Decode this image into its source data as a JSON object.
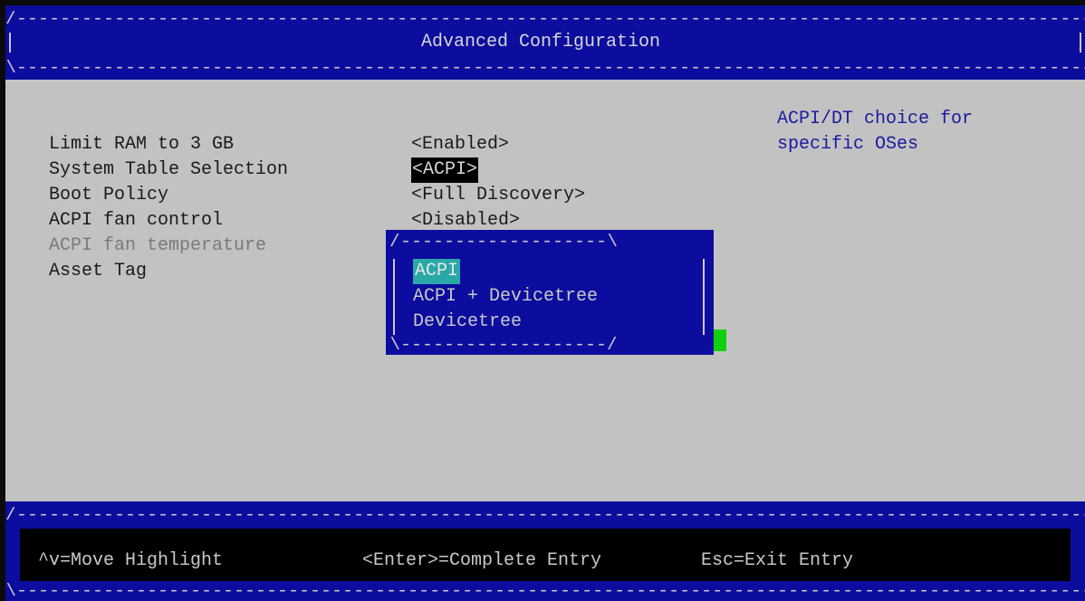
{
  "header": {
    "title": "Advanced Configuration"
  },
  "settings": [
    {
      "label": "Limit RAM to 3 GB",
      "value": "<Enabled>"
    },
    {
      "label": "System Table Selection",
      "value": "<ACPI>"
    },
    {
      "label": "Boot Policy",
      "value": "<Full Discovery>"
    },
    {
      "label": "ACPI fan control",
      "value": "<Disabled>"
    },
    {
      "label": "ACPI fan temperature",
      "value": ""
    },
    {
      "label": "Asset Tag",
      "value": ""
    }
  ],
  "help": {
    "text": "ACPI/DT choice for\nspecific OSes"
  },
  "popup": {
    "options": [
      "ACPI",
      "ACPI + Devicetree",
      "Devicetree"
    ],
    "selected": "ACPI"
  },
  "footer": {
    "keys": [
      "^v=Move Highlight",
      "<Enter>=Complete Entry",
      "Esc=Exit Entry"
    ]
  },
  "colors": {
    "frame_blue": "#0c0c9e",
    "body_gray": "#c2c2c2",
    "highlight_cyan": "#2aa8a8",
    "cursor_green": "#10d010"
  }
}
